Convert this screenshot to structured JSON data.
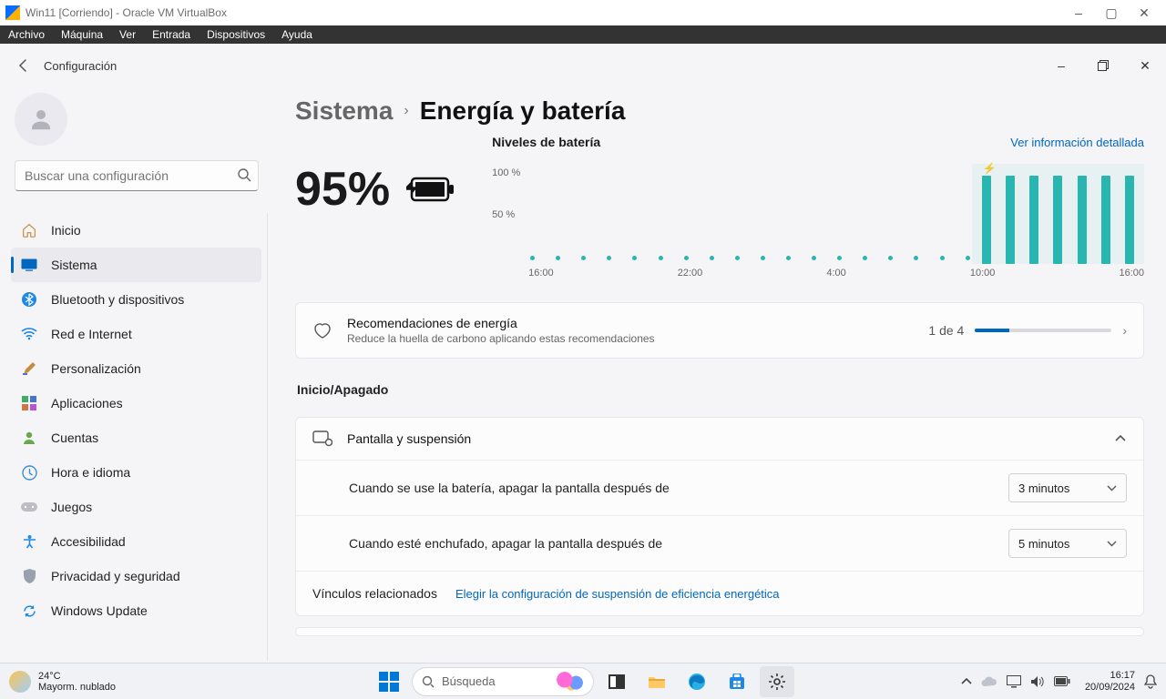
{
  "vb": {
    "title": "Win11 [Corriendo] - Oracle VM VirtualBox",
    "menu": [
      "Archivo",
      "Máquina",
      "Ver",
      "Entrada",
      "Dispositivos",
      "Ayuda"
    ]
  },
  "header": {
    "title": "Configuración"
  },
  "search": {
    "placeholder": "Buscar una configuración"
  },
  "sidebar": {
    "items": [
      {
        "label": "Inicio"
      },
      {
        "label": "Sistema"
      },
      {
        "label": "Bluetooth y dispositivos"
      },
      {
        "label": "Red e Internet"
      },
      {
        "label": "Personalización"
      },
      {
        "label": "Aplicaciones"
      },
      {
        "label": "Cuentas"
      },
      {
        "label": "Hora e idioma"
      },
      {
        "label": "Juegos"
      },
      {
        "label": "Accesibilidad"
      },
      {
        "label": "Privacidad y seguridad"
      },
      {
        "label": "Windows Update"
      }
    ]
  },
  "breadcrumb": {
    "parent": "Sistema",
    "current": "Energía y batería"
  },
  "battery": {
    "percent": "95%"
  },
  "chart": {
    "title": "Niveles de batería",
    "link": "Ver información detallada",
    "y100": "100 %",
    "y50": "50 %",
    "xlabels": [
      "16:00",
      "22:00",
      "4:00",
      "10:00",
      "16:00"
    ]
  },
  "chart_data": {
    "type": "bar",
    "title": "Niveles de batería",
    "ylabel": "%",
    "ylim": [
      0,
      100
    ],
    "x_hours": [
      "16:00",
      "17:00",
      "18:00",
      "19:00",
      "20:00",
      "21:00",
      "22:00",
      "23:00",
      "0:00",
      "1:00",
      "2:00",
      "3:00",
      "4:00",
      "5:00",
      "6:00",
      "7:00",
      "8:00",
      "9:00",
      "10:00",
      "11:00",
      "12:00",
      "13:00",
      "14:00",
      "15:00",
      "16:00"
    ],
    "series": [
      {
        "name": "sampled_level",
        "style": "dot",
        "values": [
          5,
          5,
          5,
          5,
          5,
          5,
          5,
          5,
          5,
          5,
          5,
          5,
          5,
          5,
          5,
          5,
          5,
          5,
          null,
          null,
          null,
          null,
          null,
          null,
          null
        ]
      },
      {
        "name": "charging_level",
        "style": "bar",
        "values": [
          null,
          null,
          null,
          null,
          null,
          null,
          null,
          null,
          null,
          null,
          null,
          null,
          null,
          null,
          null,
          null,
          null,
          null,
          90,
          90,
          90,
          90,
          90,
          90,
          95
        ]
      }
    ],
    "annotations": [
      "charging indicator at ~10:00"
    ]
  },
  "reco": {
    "title": "Recomendaciones de energía",
    "sub": "Reduce la huella de carbono aplicando estas recomendaciones",
    "count": "1 de 4"
  },
  "section2": {
    "title": "Inicio/Apagado"
  },
  "screen_sleep": {
    "title": "Pantalla y suspensión",
    "opt_battery_label": "Cuando se use la batería, apagar la pantalla después de",
    "opt_battery_value": "3 minutos",
    "opt_plugged_label": "Cuando esté enchufado, apagar la pantalla después de",
    "opt_plugged_value": "5 minutos"
  },
  "related": {
    "label": "Vínculos relacionados",
    "link": "Elegir la configuración de suspensión de eficiencia energética"
  },
  "taskbar": {
    "temp": "24°C",
    "weather": "Mayorm. nublado",
    "search": "Búsqueda",
    "time": "16:17",
    "date": "20/09/2024"
  }
}
